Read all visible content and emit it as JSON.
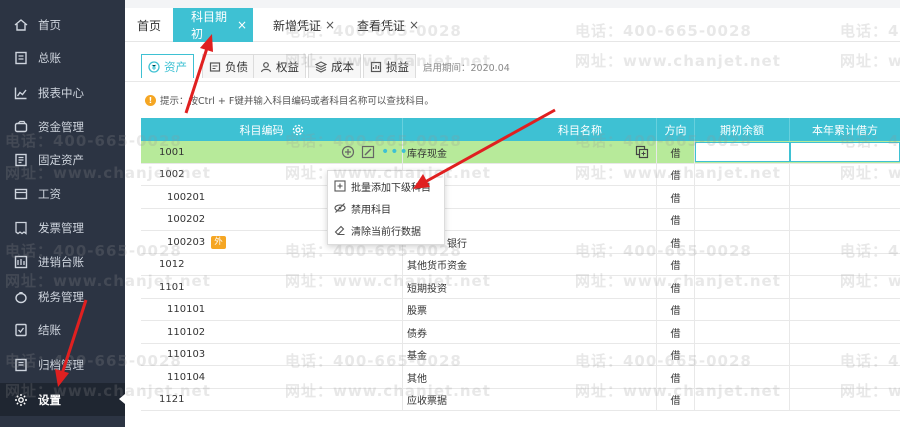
{
  "sidebar": {
    "items": [
      {
        "label": "首页",
        "icon": "home-icon"
      },
      {
        "label": "总账",
        "icon": "ledger-icon"
      },
      {
        "label": "报表中心",
        "icon": "chart-icon"
      },
      {
        "label": "资金管理",
        "icon": "money-icon"
      },
      {
        "label": "固定资产",
        "icon": "asset-icon"
      },
      {
        "label": "工资",
        "icon": "salary-icon"
      },
      {
        "label": "发票管理",
        "icon": "invoice-icon"
      },
      {
        "label": "进销台账",
        "icon": "inventory-icon"
      },
      {
        "label": "税务管理",
        "icon": "tax-icon"
      },
      {
        "label": "结账",
        "icon": "close-books-icon"
      },
      {
        "label": "归档管理",
        "icon": "archive-icon"
      },
      {
        "label": "设置",
        "icon": "gear-icon",
        "active": true
      }
    ]
  },
  "tabs": [
    {
      "label": "首页"
    },
    {
      "label": "科目期初",
      "close": "×",
      "active": true
    },
    {
      "label": "新增凭证",
      "close": "×"
    },
    {
      "label": "查看凭证",
      "close": "×"
    }
  ],
  "subtabs": [
    {
      "label": "资产",
      "icon": "asset-tab-icon",
      "active": true
    },
    {
      "label": "负债",
      "icon": "liability-icon"
    },
    {
      "label": "权益",
      "icon": "equity-icon"
    },
    {
      "label": "成本",
      "icon": "cost-icon"
    },
    {
      "label": "损益",
      "icon": "profit-loss-icon"
    }
  ],
  "period_text": "启用期间：2020.04",
  "hint": {
    "icon_text": "!",
    "text": "提示：按Ctrl + F键并输入科目编码或者科目名称可以查找科目。"
  },
  "table": {
    "headers": {
      "code": "科目编码",
      "name": "科目名称",
      "direction": "方向",
      "opening_balance": "期初余额",
      "ytd_debit": "本年累计借方"
    },
    "rows": [
      {
        "code": "1001",
        "name": "库存现金",
        "dir": "借",
        "selected": true
      },
      {
        "code": "1002",
        "name": "",
        "dir": "借"
      },
      {
        "code": "100201",
        "name": "",
        "dir": "借",
        "child": true
      },
      {
        "code": "100202",
        "name": "",
        "dir": "借",
        "child": true
      },
      {
        "code": "100203",
        "name": "银行",
        "dir": "借",
        "child": true,
        "badge": "外"
      },
      {
        "code": "1012",
        "name": "其他货币资金",
        "dir": "借"
      },
      {
        "code": "1101",
        "name": "短期投资",
        "dir": "借"
      },
      {
        "code": "110101",
        "name": "股票",
        "dir": "借",
        "child": true
      },
      {
        "code": "110102",
        "name": "债券",
        "dir": "借",
        "child": true
      },
      {
        "code": "110103",
        "name": "基金",
        "dir": "借",
        "child": true
      },
      {
        "code": "110104",
        "name": "其他",
        "dir": "借",
        "child": true
      },
      {
        "code": "1121",
        "name": "应收票据",
        "dir": "借"
      }
    ]
  },
  "context_menu": {
    "items": [
      {
        "label": "批量添加下级科目",
        "icon": "add-batch-icon"
      },
      {
        "label": "禁用科目",
        "icon": "disable-icon"
      },
      {
        "label": "清除当前行数据",
        "icon": "clear-icon"
      }
    ]
  },
  "row_tools": {
    "more": "•••"
  },
  "watermark": {
    "phone": "电话：400-665-0028",
    "site": "网址：www.chanjet.net"
  },
  "colors": {
    "sidebar_bg": "#2c3443",
    "accent": "#3ec1d3",
    "selected_row": "#b7ea9a",
    "annotation": "#e02020"
  }
}
